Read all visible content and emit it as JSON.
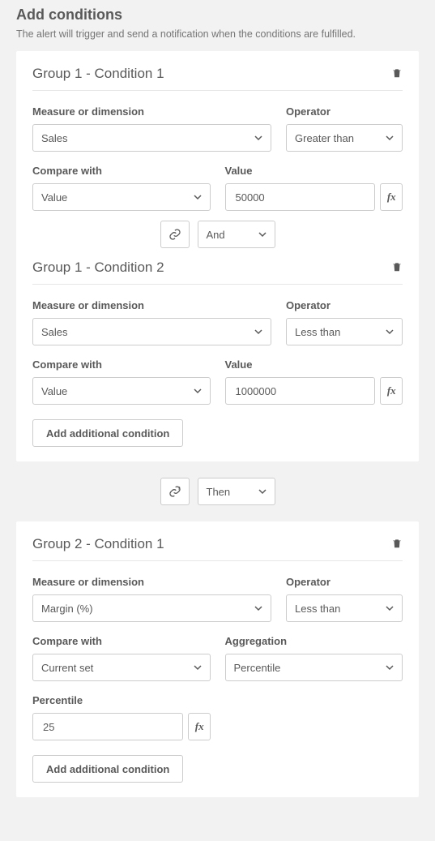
{
  "page": {
    "title": "Add conditions",
    "subtitle": "The alert will trigger and send a notification when the conditions are fulfilled."
  },
  "labels": {
    "measure": "Measure or dimension",
    "operator": "Operator",
    "compare": "Compare with",
    "value": "Value",
    "aggregation": "Aggregation",
    "percentile": "Percentile",
    "fx": "fx",
    "add": "Add additional condition"
  },
  "group1": {
    "cond1": {
      "title": "Group 1 - Condition 1",
      "measure": "Sales",
      "operator": "Greater than",
      "compare": "Value",
      "value": "50000"
    },
    "join": "And",
    "cond2": {
      "title": "Group 1 - Condition 2",
      "measure": "Sales",
      "operator": "Less than",
      "compare": "Value",
      "value": "1000000"
    }
  },
  "groupJoin": "Then",
  "group2": {
    "cond1": {
      "title": "Group 2 - Condition 1",
      "measure": "Margin (%)",
      "operator": "Less than",
      "compare": "Current set",
      "aggregation": "Percentile",
      "percentile": "25"
    }
  }
}
